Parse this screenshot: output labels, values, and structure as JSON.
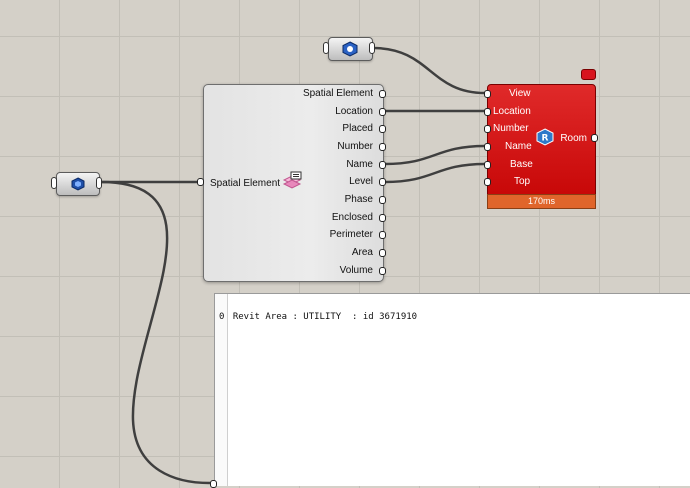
{
  "source_node": {
    "icon": "revit-element-icon"
  },
  "view_node": {
    "icon": "revit-view-icon"
  },
  "spatial_element_component": {
    "input": "Spatial Element",
    "icon": "spatial-element-icon",
    "outputs": [
      "Spatial Element",
      "Location",
      "Placed",
      "Number",
      "Name",
      "Level",
      "Phase",
      "Enclosed",
      "Perimeter",
      "Area",
      "Volume"
    ]
  },
  "room_component": {
    "inputs": [
      "View",
      "Location",
      "Number",
      "Name",
      "Base",
      "Top"
    ],
    "output": "Room",
    "icon": "revit-room-icon",
    "status_color": "#d8141e",
    "timer": "170ms"
  },
  "panel": {
    "rows": [
      {
        "index": "0",
        "text": "Revit Area : UTILITY  : id 3671910"
      }
    ]
  }
}
